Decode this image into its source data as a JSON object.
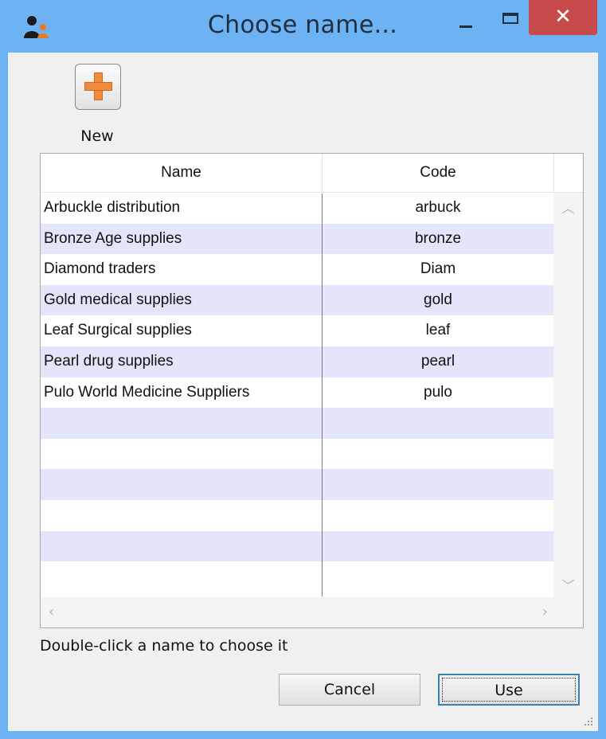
{
  "window": {
    "title": "Choose name...",
    "minimize_glyph": "–",
    "close_glyph": "✕"
  },
  "toolbar": {
    "new_label": "New",
    "new_icon": "orange-plus-icon"
  },
  "table": {
    "columns": [
      "Name",
      "Code"
    ],
    "rows": [
      {
        "name": "Arbuckle distribution",
        "code": "arbuck"
      },
      {
        "name": "Bronze Age supplies",
        "code": "bronze"
      },
      {
        "name": "Diamond traders",
        "code": "Diam"
      },
      {
        "name": "Gold medical supplies",
        "code": "gold"
      },
      {
        "name": "Leaf Surgical supplies",
        "code": "leaf"
      },
      {
        "name": "Pearl drug supplies",
        "code": "pearl"
      },
      {
        "name": "Pulo World Medicine Suppliers",
        "code": "pulo"
      },
      {
        "name": "",
        "code": ""
      },
      {
        "name": "",
        "code": ""
      },
      {
        "name": "",
        "code": ""
      },
      {
        "name": "",
        "code": ""
      },
      {
        "name": "",
        "code": ""
      },
      {
        "name": "",
        "code": ""
      }
    ]
  },
  "hint": "Double-click a name to choose it",
  "buttons": {
    "cancel": "Cancel",
    "use": "Use"
  },
  "colors": {
    "titlebar": "#6db2f2",
    "close": "#c74b4b",
    "row_alt": "#e3e5fb",
    "accent": "#f08a3c"
  }
}
